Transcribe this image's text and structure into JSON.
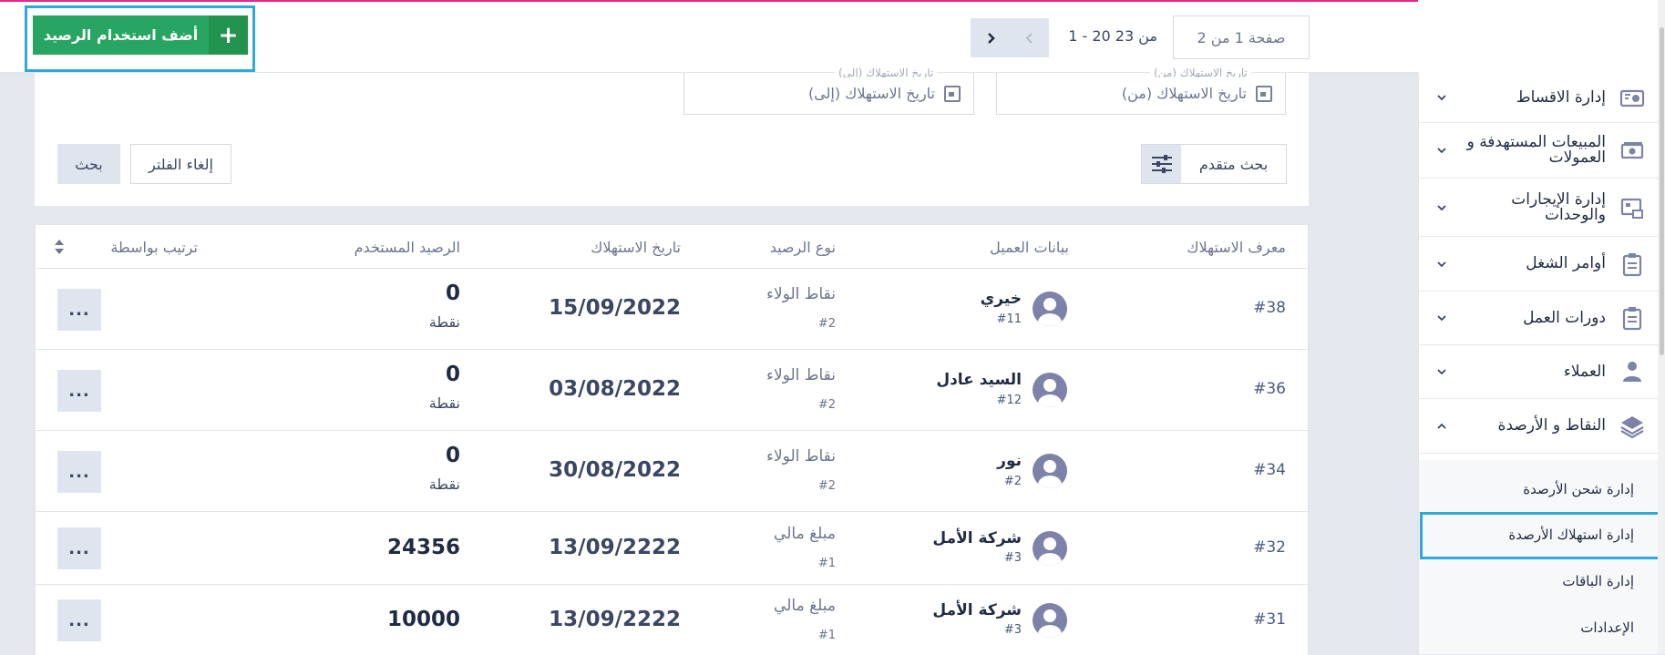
{
  "toolbar": {
    "page_info": "صفحة 1 من 2",
    "range": "1 - 20 من 23",
    "add_label": "أضف استخدام الرصيد",
    "add_icon": "+"
  },
  "filters": {
    "date_from_tag": "تاريخ الاستهلاك (من)",
    "date_from": "تاريخ الاستهلاك (من)",
    "date_to_tag": "تاريخ الاستهلاك (إلى)",
    "date_to": "تاريخ الاستهلاك (إلى)",
    "advanced": "بحث متقدم",
    "reset": "إلغاء الفلتر",
    "search": "بحث"
  },
  "table": {
    "headers": {
      "id": "معرف الاستهلاك",
      "client": "بيانات العميل",
      "type": "نوع الرصيد",
      "date": "تاريخ الاستهلاك",
      "amount": "الرصيد المستخدم",
      "sort": "ترتيب بواسطة"
    },
    "more": "...",
    "rows": [
      {
        "id": "#38",
        "name": "خيري",
        "client_no": "#11",
        "type": "نقاط الولاء",
        "type_no": "#2",
        "date": "15/09/2022",
        "amount": "0",
        "unit": "نقطة"
      },
      {
        "id": "#36",
        "name": "السيد عادل",
        "client_no": "#12",
        "type": "نقاط الولاء",
        "type_no": "#2",
        "date": "03/08/2022",
        "amount": "0",
        "unit": "نقطة"
      },
      {
        "id": "#34",
        "name": "نور",
        "client_no": "#2",
        "type": "نقاط الولاء",
        "type_no": "#2",
        "date": "30/08/2022",
        "amount": "0",
        "unit": "نقطة"
      },
      {
        "id": "#32",
        "name": "شركة الأمل",
        "client_no": "#3",
        "type": "مبلغ مالي",
        "type_no": "#1",
        "date": "13/09/2222",
        "amount": "24356",
        "unit": ""
      },
      {
        "id": "#31",
        "name": "شركة الأمل",
        "client_no": "#3",
        "type": "مبلغ مالي",
        "type_no": "#1",
        "date": "13/09/2222",
        "amount": "10000",
        "unit": ""
      }
    ]
  },
  "sidebar": {
    "items": [
      {
        "label": "إدارة الاقساط",
        "icon": "installments-icon"
      },
      {
        "label": "المبيعات المستهدفة و العمولات",
        "icon": "money-icon"
      },
      {
        "label": "إدارة الإيجارات والوحدات",
        "icon": "rentals-icon"
      },
      {
        "label": "أوامر الشغل",
        "icon": "clipboard-icon"
      },
      {
        "label": "دورات العمل",
        "icon": "clipboard-icon"
      },
      {
        "label": "العملاء",
        "icon": "person-icon"
      },
      {
        "label": "النقاط و الأرصدة",
        "icon": "layers-icon"
      }
    ],
    "subitems": [
      {
        "label": "إدارة شحن الأرصدة"
      },
      {
        "label": "إدارة استهلاك الأرصدة"
      },
      {
        "label": "إدارة الباقات"
      },
      {
        "label": "الإعدادات"
      }
    ]
  },
  "colors": {
    "accent": "#27a561",
    "highlight": "#2ea8dd",
    "brand_line": "#e5268b"
  }
}
